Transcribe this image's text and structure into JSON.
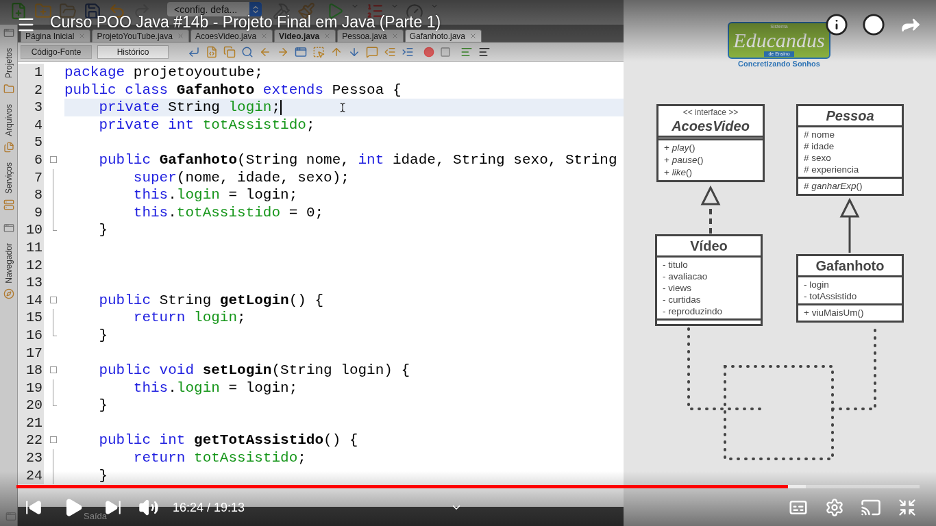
{
  "player": {
    "title": "Curso POO Java #14b - Projeto Final em Java (Parte 1)",
    "paused": true,
    "time": "16:24 / 19:13",
    "progress": {
      "level": 0.854
    },
    "buffer": {
      "level": 0.874
    }
  },
  "ide": {
    "config": "<config. defa...",
    "tabs": [
      {
        "label": "Página Inicial",
        "selected": false,
        "modified": false
      },
      {
        "label": "ProjetoYouTube.java",
        "selected": false,
        "modified": false
      },
      {
        "label": "AcoesVideo.java",
        "selected": false,
        "modified": false
      },
      {
        "label": "Video.java",
        "selected": false,
        "modified": true
      },
      {
        "label": "Pessoa.java",
        "selected": false,
        "modified": false
      },
      {
        "label": "Gafanhoto.java",
        "selected": true,
        "modified": false
      }
    ],
    "modes": [
      {
        "label": "Código-Fonte",
        "selected": true
      },
      {
        "label": "Histórico",
        "selected": false
      }
    ],
    "sidebar": [
      "Projetos",
      "Arquivos",
      "Serviços",
      "Navegador"
    ],
    "lines": [
      {
        "number": "1",
        "kind": "code",
        "current": false,
        "tokens": [
          {
            "kind": "keyword",
            "text": "package"
          },
          {
            "kind": "plain",
            "text": " projetoyoutube;"
          }
        ]
      },
      {
        "number": "2",
        "kind": "code",
        "current": false,
        "tokens": [
          {
            "kind": "keyword",
            "text": "public class "
          },
          {
            "kind": "name",
            "text": "Gafanhoto "
          },
          {
            "kind": "keyword",
            "text": "extends"
          },
          {
            "kind": "plain",
            "text": " Pessoa {"
          }
        ]
      },
      {
        "number": "3",
        "kind": "code",
        "current": true,
        "tokens": [
          {
            "kind": "keyword",
            "text": "    private"
          },
          {
            "kind": "plain",
            "text": " String "
          },
          {
            "kind": "field",
            "text": "login"
          },
          {
            "kind": "plain",
            "text": ";"
          }
        ]
      },
      {
        "number": "4",
        "kind": "code",
        "current": false,
        "tokens": [
          {
            "kind": "keyword",
            "text": "    private int "
          },
          {
            "kind": "field",
            "text": "totAssistido"
          },
          {
            "kind": "plain",
            "text": ";"
          }
        ]
      },
      {
        "number": "5",
        "kind": "code",
        "current": false
      },
      {
        "number": "6",
        "kind": "opener",
        "current": false,
        "tokens": [
          {
            "kind": "keyword",
            "text": "    public "
          },
          {
            "kind": "name",
            "text": "Gafanhoto"
          },
          {
            "kind": "plain",
            "text": "(String nome, "
          },
          {
            "kind": "keyword",
            "text": "int"
          },
          {
            "kind": "plain",
            "text": " idade, String sexo, String"
          }
        ]
      },
      {
        "number": "7",
        "kind": "body",
        "current": false,
        "tokens": [
          {
            "kind": "keyword",
            "text": "        super"
          },
          {
            "kind": "plain",
            "text": "(nome, idade, sexo);"
          }
        ]
      },
      {
        "number": "8",
        "kind": "body",
        "current": false,
        "tokens": [
          {
            "kind": "keyword",
            "text": "        this"
          },
          {
            "kind": "plain",
            "text": "."
          },
          {
            "kind": "field",
            "text": "login"
          },
          {
            "kind": "plain",
            "text": " = login;"
          }
        ]
      },
      {
        "number": "9",
        "kind": "body",
        "current": false,
        "tokens": [
          {
            "kind": "keyword",
            "text": "        this"
          },
          {
            "kind": "plain",
            "text": "."
          },
          {
            "kind": "field",
            "text": "totAssistido"
          },
          {
            "kind": "plain",
            "text": " = 0;"
          }
        ]
      },
      {
        "number": "10",
        "kind": "closer",
        "current": false,
        "tokens": [
          {
            "kind": "plain",
            "text": "    }"
          }
        ]
      },
      {
        "number": "11",
        "kind": "code",
        "current": false
      },
      {
        "number": "12",
        "kind": "code",
        "current": false
      },
      {
        "number": "13",
        "kind": "code",
        "current": false
      },
      {
        "number": "14",
        "kind": "opener",
        "current": false,
        "tokens": [
          {
            "kind": "keyword",
            "text": "    public"
          },
          {
            "kind": "plain",
            "text": " String "
          },
          {
            "kind": "name",
            "text": "getLogin"
          },
          {
            "kind": "plain",
            "text": "() {"
          }
        ]
      },
      {
        "number": "15",
        "kind": "body",
        "current": false,
        "tokens": [
          {
            "kind": "keyword",
            "text": "        return "
          },
          {
            "kind": "field",
            "text": "login"
          },
          {
            "kind": "plain",
            "text": ";"
          }
        ]
      },
      {
        "number": "16",
        "kind": "closer",
        "current": false,
        "tokens": [
          {
            "kind": "plain",
            "text": "    }"
          }
        ]
      },
      {
        "number": "17",
        "kind": "code",
        "current": false
      },
      {
        "number": "18",
        "kind": "opener",
        "current": false,
        "tokens": [
          {
            "kind": "keyword",
            "text": "    public void "
          },
          {
            "kind": "name",
            "text": "setLogin"
          },
          {
            "kind": "plain",
            "text": "(String login) {"
          }
        ]
      },
      {
        "number": "19",
        "kind": "body",
        "current": false,
        "tokens": [
          {
            "kind": "keyword",
            "text": "        this"
          },
          {
            "kind": "plain",
            "text": "."
          },
          {
            "kind": "field",
            "text": "login"
          },
          {
            "kind": "plain",
            "text": " = login;"
          }
        ]
      },
      {
        "number": "20",
        "kind": "closer",
        "current": false,
        "tokens": [
          {
            "kind": "plain",
            "text": "    }"
          }
        ]
      },
      {
        "number": "21",
        "kind": "code",
        "current": false
      },
      {
        "number": "22",
        "kind": "opener",
        "current": false,
        "tokens": [
          {
            "kind": "keyword",
            "text": "    public int "
          },
          {
            "kind": "name",
            "text": "getTotAssistido"
          },
          {
            "kind": "plain",
            "text": "() {"
          }
        ]
      },
      {
        "number": "23",
        "kind": "body",
        "current": false,
        "tokens": [
          {
            "kind": "keyword",
            "text": "        return "
          },
          {
            "kind": "field",
            "text": "totAssistido"
          },
          {
            "kind": "plain",
            "text": ";"
          }
        ]
      },
      {
        "number": "24",
        "kind": "body",
        "current": false,
        "tokens": [
          {
            "kind": "plain",
            "text": "    }"
          }
        ]
      }
    ],
    "bottom_tab": "Saída"
  },
  "slide": {
    "logo": {
      "top": "Sistema",
      "name": "Educandus",
      "sub": "de Ensino",
      "slogan": "Concretizando Sonhos"
    },
    "classes": [
      {
        "stereotype": "<< interface >>",
        "name": "AcoesVideo",
        "italic": true,
        "methods": [
          "+ *play*()",
          "+ *pause*()",
          "+ *like*()"
        ]
      },
      {
        "name": "Pessoa",
        "italic": true,
        "attributes": [
          "# nome",
          "# idade",
          "# sexo",
          "# experiencia"
        ],
        "methods": [
          "# *ganharExp*()"
        ]
      },
      {
        "name": "Vídeo",
        "italic": false,
        "attributes": [
          "- titulo",
          "- avaliacao",
          "- views",
          "- curtidas",
          "- reproduzindo"
        ]
      },
      {
        "name": "Gafanhoto",
        "italic": false,
        "attributes": [
          "- login",
          "- totAssistido"
        ],
        "methods": [
          "+ viuMaisUm()"
        ]
      }
    ]
  }
}
